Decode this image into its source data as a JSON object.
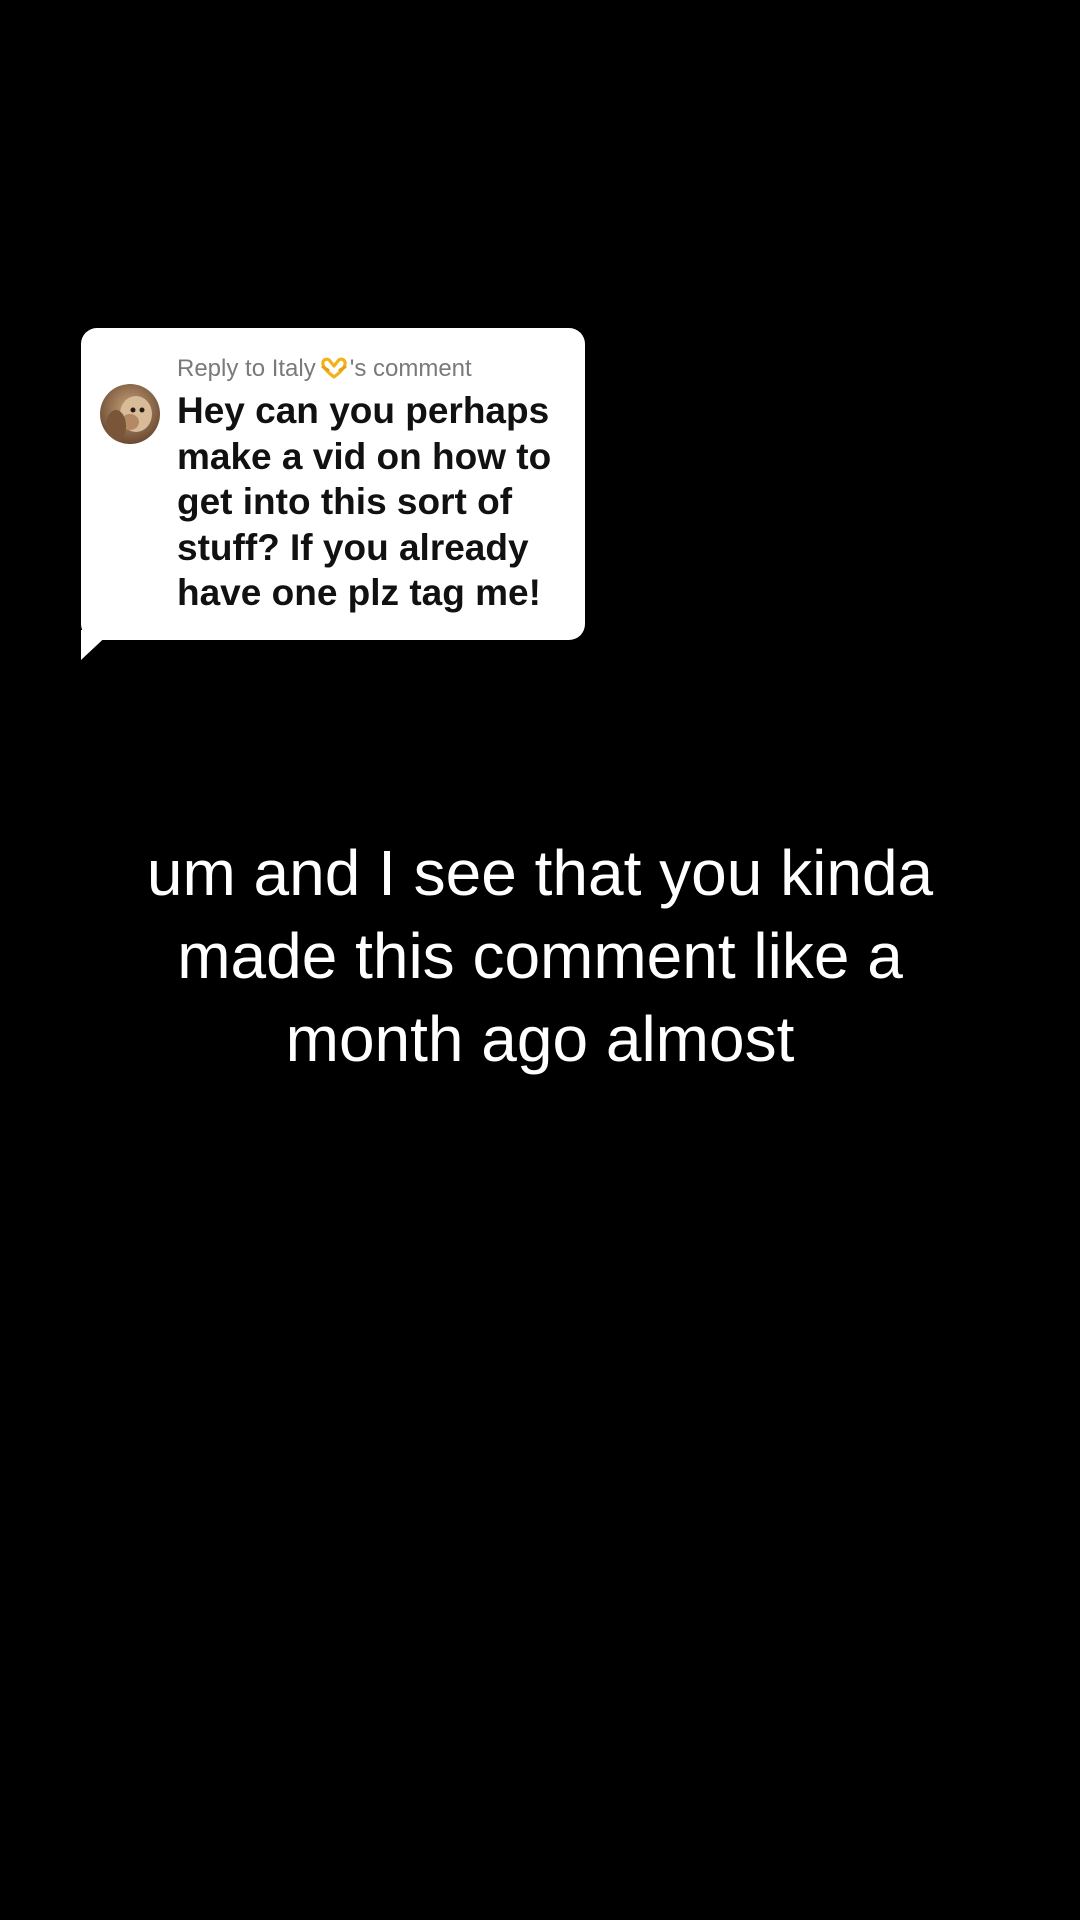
{
  "colors": {
    "background": "#000000",
    "bubble": "#ffffff",
    "header_text": "#7a7a7a",
    "body_text": "#111111",
    "caption_text": "#ffffff"
  },
  "reply": {
    "header_prefix": "Reply to Italy",
    "header_emoji": "heart-hands-emoji",
    "header_suffix": "'s comment",
    "avatar_icon": "user-avatar-photo",
    "body_lines": [
      "Hey can you perhaps",
      "make a vid on how to",
      "get into this sort of",
      "stuff? If you already",
      "have one plz tag me!"
    ]
  },
  "caption": {
    "lines": [
      "um and I see that you kinda",
      "made this comment like a",
      "month ago almost"
    ]
  }
}
